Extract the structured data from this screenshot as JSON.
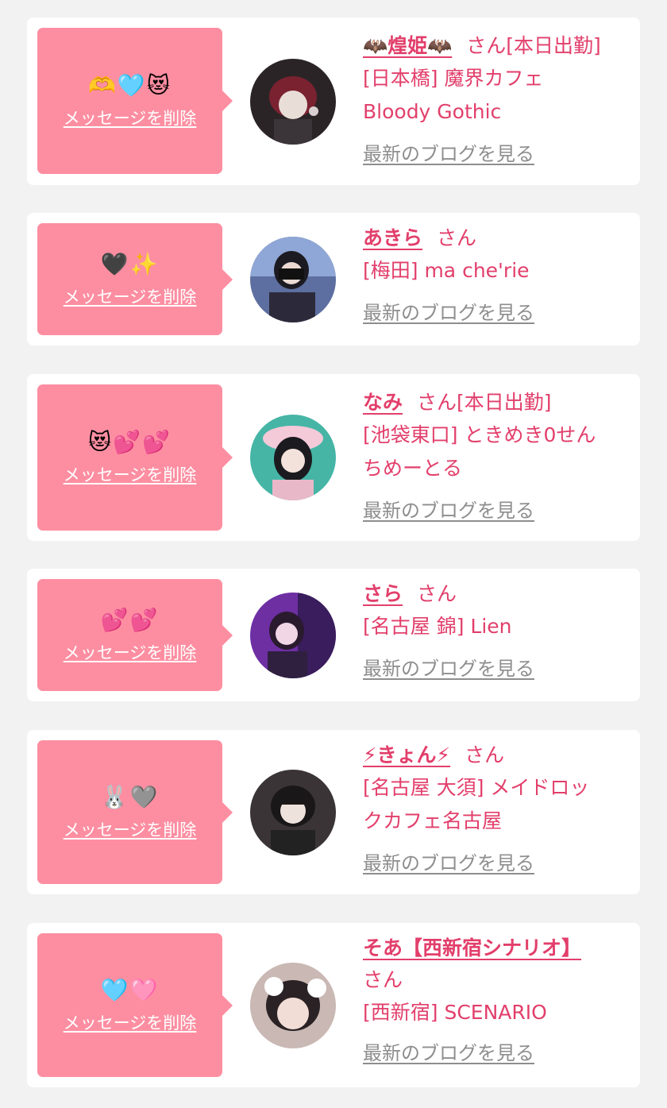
{
  "messages": [
    {
      "emoji": "🫶🩵😻",
      "delete_label": "メッセージを削除",
      "name": "🦇煌姫🦇",
      "honorific": "さん",
      "status": "[本日出勤]",
      "shop_lines": [
        "[日本橋] 魔界カフェ",
        "Bloody Gothic"
      ],
      "blog_label": "最新のブログを見る"
    },
    {
      "emoji": "🖤✨",
      "delete_label": "メッセージを削除",
      "name": "あきら",
      "honorific": "さん",
      "status": "",
      "shop_lines": [
        "[梅田] ma che'rie"
      ],
      "blog_label": "最新のブログを見る"
    },
    {
      "emoji": "😻💕💕",
      "delete_label": "メッセージを削除",
      "name": "なみ",
      "honorific": "さん",
      "status": "[本日出勤]",
      "shop_lines": [
        "[池袋東口] ときめき0せん",
        "ちめーとる"
      ],
      "blog_label": "最新のブログを見る"
    },
    {
      "emoji": "💕💕",
      "delete_label": "メッセージを削除",
      "name": "さら",
      "honorific": "さん",
      "status": "",
      "shop_lines": [
        "[名古屋 錦] Lien"
      ],
      "blog_label": "最新のブログを見る"
    },
    {
      "emoji": "🐰🩶",
      "delete_label": "メッセージを削除",
      "name": "⚡きょん⚡",
      "honorific": "さん",
      "status": "",
      "shop_lines": [
        "[名古屋 大須] メイドロッ",
        "クカフェ名古屋"
      ],
      "blog_label": "最新のブログを見る"
    },
    {
      "emoji": "🩵🩷",
      "delete_label": "メッセージを削除",
      "name": "そあ【西新宿シナリオ】",
      "honorific": "さん",
      "status": "",
      "shop_lines": [
        "[西新宿] SCENARIO"
      ],
      "blog_label": "最新のブログを見る"
    }
  ],
  "colors": {
    "page_bg": "#f2f2f2",
    "card_bg": "#ffffff",
    "bubble_bg": "#fd8ea1",
    "accent_text": "#e23f6b",
    "muted_text": "#8e8e8e"
  }
}
